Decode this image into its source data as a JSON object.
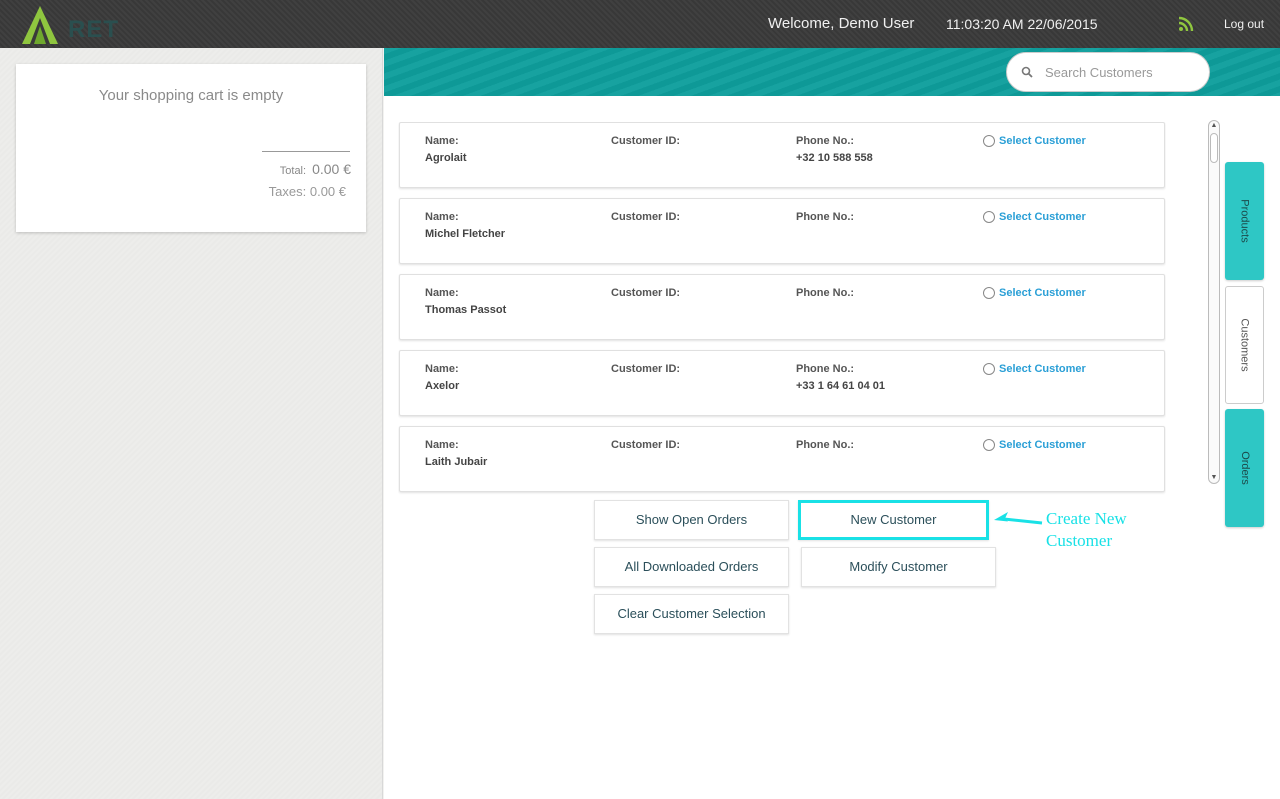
{
  "header": {
    "logo_text": "RET",
    "welcome": "Welcome, Demo User",
    "datetime": "11:03:20 AM 22/06/2015",
    "rss_icon": "rss-icon",
    "logout": "Log out"
  },
  "cart": {
    "empty_message": "Your shopping cart is empty",
    "total_label": "Total:",
    "total_value": "0.00 €",
    "taxes": "Taxes: 0.00 €"
  },
  "search": {
    "placeholder": "Search Customers",
    "value": ""
  },
  "customers": {
    "name_label": "Name:",
    "id_label": "Customer ID:",
    "phone_label": "Phone No.:",
    "select_label": "Select Customer",
    "rows": [
      {
        "name": "Agrolait",
        "id": "",
        "phone": "+32 10 588 558"
      },
      {
        "name": "Michel Fletcher",
        "id": "",
        "phone": ""
      },
      {
        "name": "Thomas Passot",
        "id": "",
        "phone": ""
      },
      {
        "name": "Axelor",
        "id": "",
        "phone": "+33 1 64 61 04 01"
      },
      {
        "name": "Laith Jubair",
        "id": "",
        "phone": ""
      }
    ]
  },
  "tabs": {
    "products": "Products",
    "customers": "Customers",
    "orders": "Orders"
  },
  "actions": {
    "show_open_orders": "Show Open Orders",
    "new_customer": "New Customer",
    "all_downloaded_orders": "All Downloaded Orders",
    "modify_customer": "Modify Customer",
    "clear_selection": "Clear Customer Selection"
  },
  "annotation": {
    "line1": "Create New",
    "line2": "Customer",
    "color": "#19e1e6"
  },
  "colors": {
    "accent_teal": "#0e9e9c",
    "tab_teal": "#2ec7c5",
    "link_blue": "#2a9fd6",
    "topbar": "#3a3a3a"
  }
}
